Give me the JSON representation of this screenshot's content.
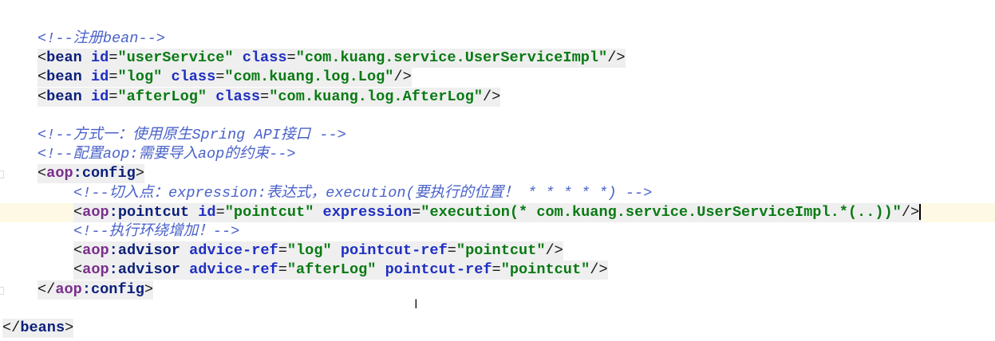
{
  "colors": {
    "comment": "#4a62c9",
    "namespace": "#7a2e8c",
    "tag": "#0b1f7a",
    "attribute": "#1f2fc2",
    "value": "#0a7a14",
    "caret_line": "#fdf9e4"
  },
  "lines": [
    {
      "indent": 1,
      "tokens": [
        {
          "c": "comment",
          "t": "<!--注册bean-->"
        }
      ]
    },
    {
      "indent": 1,
      "bg": true,
      "tokens": [
        {
          "c": "bracket",
          "t": "<"
        },
        {
          "c": "tag",
          "t": "bean"
        },
        {
          "c": "eq",
          "t": " "
        },
        {
          "c": "attr",
          "t": "id"
        },
        {
          "c": "eq",
          "t": "="
        },
        {
          "c": "value",
          "t": "\"userService\""
        },
        {
          "c": "eq",
          "t": " "
        },
        {
          "c": "attr",
          "t": "class"
        },
        {
          "c": "eq",
          "t": "="
        },
        {
          "c": "value",
          "t": "\"com.kuang.service.UserServiceImpl\""
        },
        {
          "c": "bracket",
          "t": "/>"
        }
      ]
    },
    {
      "indent": 1,
      "bg": true,
      "tokens": [
        {
          "c": "bracket",
          "t": "<"
        },
        {
          "c": "tag",
          "t": "bean"
        },
        {
          "c": "eq",
          "t": " "
        },
        {
          "c": "attr",
          "t": "id"
        },
        {
          "c": "eq",
          "t": "="
        },
        {
          "c": "value",
          "t": "\"log\""
        },
        {
          "c": "eq",
          "t": " "
        },
        {
          "c": "attr",
          "t": "class"
        },
        {
          "c": "eq",
          "t": "="
        },
        {
          "c": "value",
          "t": "\"com.kuang.log.Log\""
        },
        {
          "c": "bracket",
          "t": "/>"
        }
      ]
    },
    {
      "indent": 1,
      "bg": true,
      "tokens": [
        {
          "c": "bracket",
          "t": "<"
        },
        {
          "c": "tag",
          "t": "bean"
        },
        {
          "c": "eq",
          "t": " "
        },
        {
          "c": "attr",
          "t": "id"
        },
        {
          "c": "eq",
          "t": "="
        },
        {
          "c": "value",
          "t": "\"afterLog\""
        },
        {
          "c": "eq",
          "t": " "
        },
        {
          "c": "attr",
          "t": "class"
        },
        {
          "c": "eq",
          "t": "="
        },
        {
          "c": "value",
          "t": "\"com.kuang.log.AfterLog\""
        },
        {
          "c": "bracket",
          "t": "/>"
        }
      ]
    },
    {
      "indent": 0,
      "tokens": []
    },
    {
      "indent": 1,
      "tokens": [
        {
          "c": "comment",
          "t": "<!--方式一：使用原生Spring API接口 -->"
        }
      ]
    },
    {
      "indent": 1,
      "tokens": [
        {
          "c": "comment",
          "t": "<!--配置aop:需要导入aop的约束-->"
        }
      ]
    },
    {
      "indent": 1,
      "bg": true,
      "fold": true,
      "tokens": [
        {
          "c": "bracket",
          "t": "<"
        },
        {
          "c": "ns",
          "t": "aop"
        },
        {
          "c": "tag",
          "t": ":config"
        },
        {
          "c": "bracket",
          "t": ">"
        }
      ]
    },
    {
      "indent": 2,
      "tokens": [
        {
          "c": "comment",
          "t": "<!--切入点：expression:表达式，execution(要执行的位置！ * * * * *) -->"
        }
      ]
    },
    {
      "indent": 2,
      "bg": true,
      "caret": true,
      "tokens": [
        {
          "c": "bracket",
          "t": "<"
        },
        {
          "c": "ns",
          "t": "aop"
        },
        {
          "c": "tag",
          "t": ":pointcut"
        },
        {
          "c": "eq",
          "t": " "
        },
        {
          "c": "attr",
          "t": "id"
        },
        {
          "c": "eq",
          "t": "="
        },
        {
          "c": "value",
          "t": "\"pointcut\""
        },
        {
          "c": "eq",
          "t": " "
        },
        {
          "c": "attr",
          "t": "expression"
        },
        {
          "c": "eq",
          "t": "="
        },
        {
          "c": "value",
          "t": "\"execution(* com.kuang.service.UserServiceImpl.*(..))\""
        },
        {
          "c": "bracket",
          "t": "/>"
        }
      ]
    },
    {
      "indent": 2,
      "tokens": [
        {
          "c": "comment",
          "t": "<!--执行环绕增加！-->"
        }
      ]
    },
    {
      "indent": 2,
      "bg": true,
      "tokens": [
        {
          "c": "bracket",
          "t": "<"
        },
        {
          "c": "ns",
          "t": "aop"
        },
        {
          "c": "tag",
          "t": ":advisor"
        },
        {
          "c": "eq",
          "t": " "
        },
        {
          "c": "attr",
          "t": "advice-ref"
        },
        {
          "c": "eq",
          "t": "="
        },
        {
          "c": "value",
          "t": "\"log\""
        },
        {
          "c": "eq",
          "t": " "
        },
        {
          "c": "attr",
          "t": "pointcut-ref"
        },
        {
          "c": "eq",
          "t": "="
        },
        {
          "c": "value",
          "t": "\"pointcut\""
        },
        {
          "c": "bracket",
          "t": "/>"
        }
      ]
    },
    {
      "indent": 2,
      "bg": true,
      "tokens": [
        {
          "c": "bracket",
          "t": "<"
        },
        {
          "c": "ns",
          "t": "aop"
        },
        {
          "c": "tag",
          "t": ":advisor"
        },
        {
          "c": "eq",
          "t": " "
        },
        {
          "c": "attr",
          "t": "advice-ref"
        },
        {
          "c": "eq",
          "t": "="
        },
        {
          "c": "value",
          "t": "\"afterLog\""
        },
        {
          "c": "eq",
          "t": " "
        },
        {
          "c": "attr",
          "t": "pointcut-ref"
        },
        {
          "c": "eq",
          "t": "="
        },
        {
          "c": "value",
          "t": "\"pointcut\""
        },
        {
          "c": "bracket",
          "t": "/>"
        }
      ]
    },
    {
      "indent": 1,
      "bg": true,
      "fold": true,
      "tokens": [
        {
          "c": "bracket",
          "t": "</"
        },
        {
          "c": "ns",
          "t": "aop"
        },
        {
          "c": "tag",
          "t": ":config"
        },
        {
          "c": "bracket",
          "t": ">"
        }
      ]
    },
    {
      "indent": 0,
      "tokens": []
    },
    {
      "indent": 0,
      "bg": true,
      "tokens": [
        {
          "c": "bracket",
          "t": "</"
        },
        {
          "c": "tag",
          "t": "beans"
        },
        {
          "c": "bracket",
          "t": ">"
        }
      ]
    }
  ]
}
